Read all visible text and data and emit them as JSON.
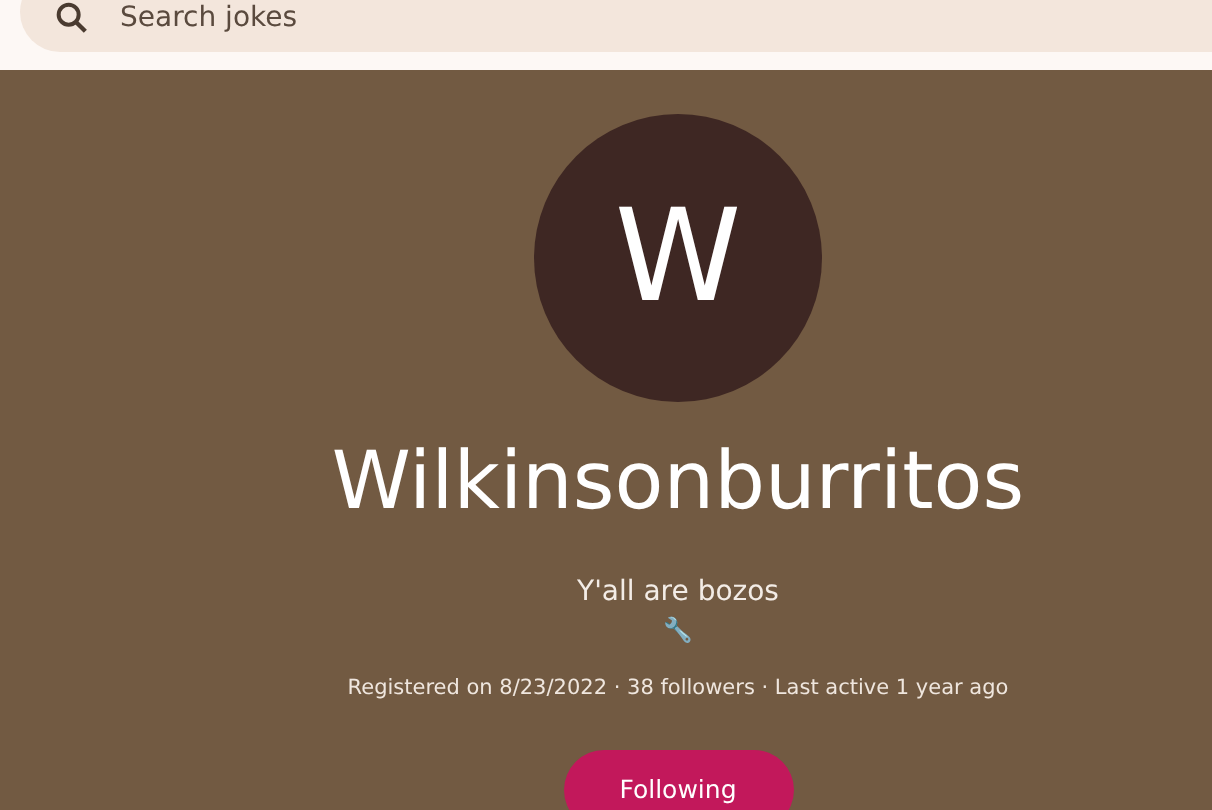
{
  "search": {
    "placeholder": "Search jokes"
  },
  "profile": {
    "initial": "W",
    "name": "Wilkinsonburritos",
    "bio": "Y'all are bozos",
    "emoji": "🔧",
    "meta": "Registered on 8/23/2022 · 38 followers · Last active 1 year ago"
  },
  "follow_button": {
    "label": "Following",
    "selected": true
  }
}
